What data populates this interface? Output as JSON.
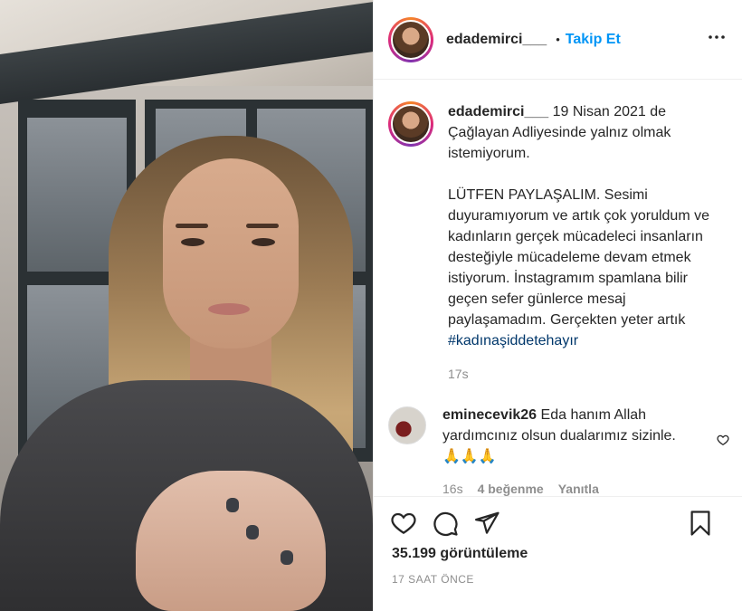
{
  "header": {
    "username": "edademirci___",
    "separator": "•",
    "follow_label": "Takip Et",
    "more_label": "•••"
  },
  "caption": {
    "username": "edademirci___",
    "text_1": " 19 Nisan 2021 de Çağlayan Adliyesinde yalnız olmak istemiyorum.",
    "text_2": "LÜTFEN PAYLAŞALIM. Sesimi duyuramıyorum ve artık çok yoruldum ve kadınların gerçek mücadeleci insanların desteğiyle mücadeleme devam etmek istiyorum. İnstagramım spamlana bilir geçen sefer günlerce mesaj paylaşamadım. Gerçekten yeter artık ",
    "hashtag": "#kadınaşiddetehayır",
    "time": "17s"
  },
  "comment": {
    "username": "eminecevik26",
    "text": " Eda hanım Allah yardımcınız olsun dualarımız sizinle.🙏🙏🙏",
    "time": "16s",
    "likes": "4 beğenme",
    "reply": "Yanıtla"
  },
  "stats": {
    "views": "35.199 görüntüleme",
    "ago": "17 SAAT ÖNCE"
  },
  "icons": [
    "heart-icon",
    "comment-icon",
    "share-icon",
    "bookmark-icon",
    "more-icon"
  ],
  "colors": {
    "accent": "#0095f6",
    "hashtag": "#00376b",
    "muted": "#8e8e8e"
  }
}
